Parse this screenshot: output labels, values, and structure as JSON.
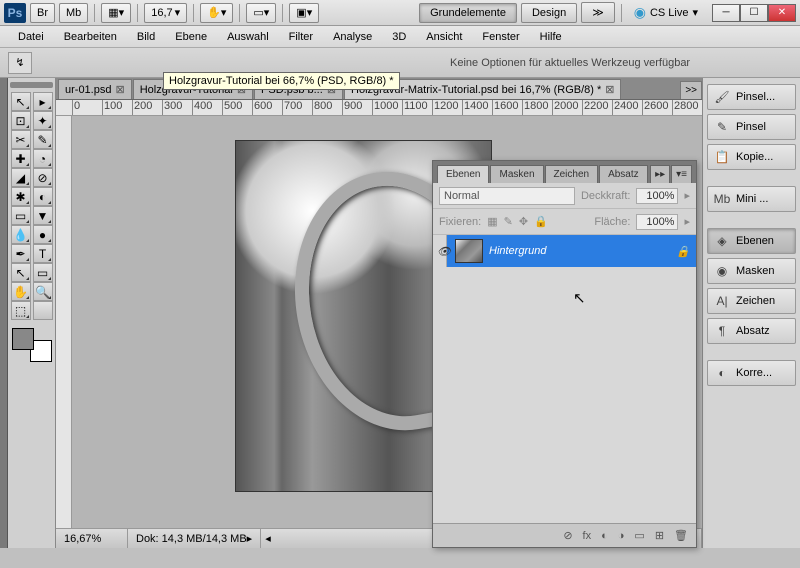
{
  "titlebar": {
    "apps": [
      "Br",
      "Mb"
    ],
    "zoom": "16,7",
    "workspaces": {
      "primary": "Grundelemente",
      "secondary": "Design"
    },
    "cslive": "CS Live"
  },
  "menu": [
    "Datei",
    "Bearbeiten",
    "Bild",
    "Ebene",
    "Auswahl",
    "Filter",
    "Analyse",
    "3D",
    "Ansicht",
    "Fenster",
    "Hilfe"
  ],
  "options_bar": {
    "tooltip": "Holzgravur-Tutorial bei 66,7% (PSD, RGB/8) *",
    "message": "Keine Optionen für aktuelles Werkzeug verfügbar"
  },
  "tabs": [
    {
      "label": "ur-01.psd",
      "active": false
    },
    {
      "label": "Holzgravur-Tutorial",
      "active": false
    },
    {
      "label": "PSD.psb b...",
      "active": false
    },
    {
      "label": "Holzgravur-Matrix-Tutorial.psd bei 16,7% (RGB/8) *",
      "active": true
    }
  ],
  "tabs_overflow": ">>",
  "ruler_ticks": [
    "0",
    "100",
    "200",
    "300",
    "400",
    "500",
    "600",
    "700",
    "800",
    "900",
    "1000",
    "1100",
    "1200",
    "1400",
    "1600",
    "1800",
    "2000",
    "2200",
    "2400",
    "2600",
    "2800",
    "300"
  ],
  "status": {
    "zoom": "16,67%",
    "doc": "Dok: 14,3 MB/14,3 MB"
  },
  "layers_panel": {
    "tabs": [
      "Ebenen",
      "Masken",
      "Zeichen",
      "Absatz"
    ],
    "active_tab": 0,
    "blend_mode": "Normal",
    "opacity_label": "Deckkraft:",
    "opacity_value": "100%",
    "lock_label": "Fixieren:",
    "fill_label": "Fläche:",
    "fill_value": "100%",
    "layers": [
      {
        "name": "Hintergrund",
        "locked": true,
        "visible": true
      }
    ],
    "bottom_icons": [
      "⊘",
      "fx",
      "◐",
      "◑",
      "▭",
      "⊞",
      "🗑"
    ]
  },
  "right_panels": [
    {
      "icon": "🖌",
      "label": "Pinsel..."
    },
    {
      "icon": "✎",
      "label": "Pinsel"
    },
    {
      "icon": "📋",
      "label": "Kopie..."
    },
    {
      "sep": true
    },
    {
      "icon": "Mb",
      "label": "Mini ..."
    },
    {
      "sep": true
    },
    {
      "icon": "◈",
      "label": "Ebenen",
      "active": true
    },
    {
      "icon": "◉",
      "label": "Masken"
    },
    {
      "icon": "A|",
      "label": "Zeichen"
    },
    {
      "icon": "¶",
      "label": "Absatz"
    },
    {
      "sep": true
    },
    {
      "icon": "◐",
      "label": "Korre..."
    }
  ],
  "tool_icons": [
    [
      "↖",
      "▸"
    ],
    [
      "⊡",
      "✦"
    ],
    [
      "✂",
      "✎"
    ],
    [
      "✚",
      "◔"
    ],
    [
      "◢",
      "⊘"
    ],
    [
      "✱",
      "◐"
    ],
    [
      "▭",
      "▼"
    ],
    [
      "💧",
      "●"
    ],
    [
      "✒",
      "T"
    ],
    [
      "↖",
      "▭"
    ],
    [
      "✋",
      "🔍"
    ],
    [
      "⬚",
      ""
    ]
  ]
}
